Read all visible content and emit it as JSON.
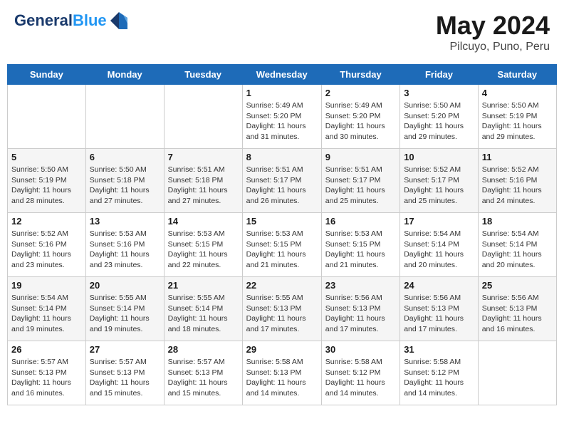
{
  "header": {
    "logo": {
      "line1": "General",
      "line2": "Blue"
    },
    "title": "May 2024",
    "subtitle": "Pilcuyo, Puno, Peru"
  },
  "days_of_week": [
    "Sunday",
    "Monday",
    "Tuesday",
    "Wednesday",
    "Thursday",
    "Friday",
    "Saturday"
  ],
  "weeks": [
    {
      "days": [
        {
          "num": "",
          "info": ""
        },
        {
          "num": "",
          "info": ""
        },
        {
          "num": "",
          "info": ""
        },
        {
          "num": "1",
          "info": "Sunrise: 5:49 AM\nSunset: 5:20 PM\nDaylight: 11 hours\nand 31 minutes."
        },
        {
          "num": "2",
          "info": "Sunrise: 5:49 AM\nSunset: 5:20 PM\nDaylight: 11 hours\nand 30 minutes."
        },
        {
          "num": "3",
          "info": "Sunrise: 5:50 AM\nSunset: 5:20 PM\nDaylight: 11 hours\nand 29 minutes."
        },
        {
          "num": "4",
          "info": "Sunrise: 5:50 AM\nSunset: 5:19 PM\nDaylight: 11 hours\nand 29 minutes."
        }
      ]
    },
    {
      "days": [
        {
          "num": "5",
          "info": "Sunrise: 5:50 AM\nSunset: 5:19 PM\nDaylight: 11 hours\nand 28 minutes."
        },
        {
          "num": "6",
          "info": "Sunrise: 5:50 AM\nSunset: 5:18 PM\nDaylight: 11 hours\nand 27 minutes."
        },
        {
          "num": "7",
          "info": "Sunrise: 5:51 AM\nSunset: 5:18 PM\nDaylight: 11 hours\nand 27 minutes."
        },
        {
          "num": "8",
          "info": "Sunrise: 5:51 AM\nSunset: 5:17 PM\nDaylight: 11 hours\nand 26 minutes."
        },
        {
          "num": "9",
          "info": "Sunrise: 5:51 AM\nSunset: 5:17 PM\nDaylight: 11 hours\nand 25 minutes."
        },
        {
          "num": "10",
          "info": "Sunrise: 5:52 AM\nSunset: 5:17 PM\nDaylight: 11 hours\nand 25 minutes."
        },
        {
          "num": "11",
          "info": "Sunrise: 5:52 AM\nSunset: 5:16 PM\nDaylight: 11 hours\nand 24 minutes."
        }
      ]
    },
    {
      "days": [
        {
          "num": "12",
          "info": "Sunrise: 5:52 AM\nSunset: 5:16 PM\nDaylight: 11 hours\nand 23 minutes."
        },
        {
          "num": "13",
          "info": "Sunrise: 5:53 AM\nSunset: 5:16 PM\nDaylight: 11 hours\nand 23 minutes."
        },
        {
          "num": "14",
          "info": "Sunrise: 5:53 AM\nSunset: 5:15 PM\nDaylight: 11 hours\nand 22 minutes."
        },
        {
          "num": "15",
          "info": "Sunrise: 5:53 AM\nSunset: 5:15 PM\nDaylight: 11 hours\nand 21 minutes."
        },
        {
          "num": "16",
          "info": "Sunrise: 5:53 AM\nSunset: 5:15 PM\nDaylight: 11 hours\nand 21 minutes."
        },
        {
          "num": "17",
          "info": "Sunrise: 5:54 AM\nSunset: 5:14 PM\nDaylight: 11 hours\nand 20 minutes."
        },
        {
          "num": "18",
          "info": "Sunrise: 5:54 AM\nSunset: 5:14 PM\nDaylight: 11 hours\nand 20 minutes."
        }
      ]
    },
    {
      "days": [
        {
          "num": "19",
          "info": "Sunrise: 5:54 AM\nSunset: 5:14 PM\nDaylight: 11 hours\nand 19 minutes."
        },
        {
          "num": "20",
          "info": "Sunrise: 5:55 AM\nSunset: 5:14 PM\nDaylight: 11 hours\nand 19 minutes."
        },
        {
          "num": "21",
          "info": "Sunrise: 5:55 AM\nSunset: 5:14 PM\nDaylight: 11 hours\nand 18 minutes."
        },
        {
          "num": "22",
          "info": "Sunrise: 5:55 AM\nSunset: 5:13 PM\nDaylight: 11 hours\nand 17 minutes."
        },
        {
          "num": "23",
          "info": "Sunrise: 5:56 AM\nSunset: 5:13 PM\nDaylight: 11 hours\nand 17 minutes."
        },
        {
          "num": "24",
          "info": "Sunrise: 5:56 AM\nSunset: 5:13 PM\nDaylight: 11 hours\nand 17 minutes."
        },
        {
          "num": "25",
          "info": "Sunrise: 5:56 AM\nSunset: 5:13 PM\nDaylight: 11 hours\nand 16 minutes."
        }
      ]
    },
    {
      "days": [
        {
          "num": "26",
          "info": "Sunrise: 5:57 AM\nSunset: 5:13 PM\nDaylight: 11 hours\nand 16 minutes."
        },
        {
          "num": "27",
          "info": "Sunrise: 5:57 AM\nSunset: 5:13 PM\nDaylight: 11 hours\nand 15 minutes."
        },
        {
          "num": "28",
          "info": "Sunrise: 5:57 AM\nSunset: 5:13 PM\nDaylight: 11 hours\nand 15 minutes."
        },
        {
          "num": "29",
          "info": "Sunrise: 5:58 AM\nSunset: 5:13 PM\nDaylight: 11 hours\nand 14 minutes."
        },
        {
          "num": "30",
          "info": "Sunrise: 5:58 AM\nSunset: 5:12 PM\nDaylight: 11 hours\nand 14 minutes."
        },
        {
          "num": "31",
          "info": "Sunrise: 5:58 AM\nSunset: 5:12 PM\nDaylight: 11 hours\nand 14 minutes."
        },
        {
          "num": "",
          "info": ""
        }
      ]
    }
  ]
}
